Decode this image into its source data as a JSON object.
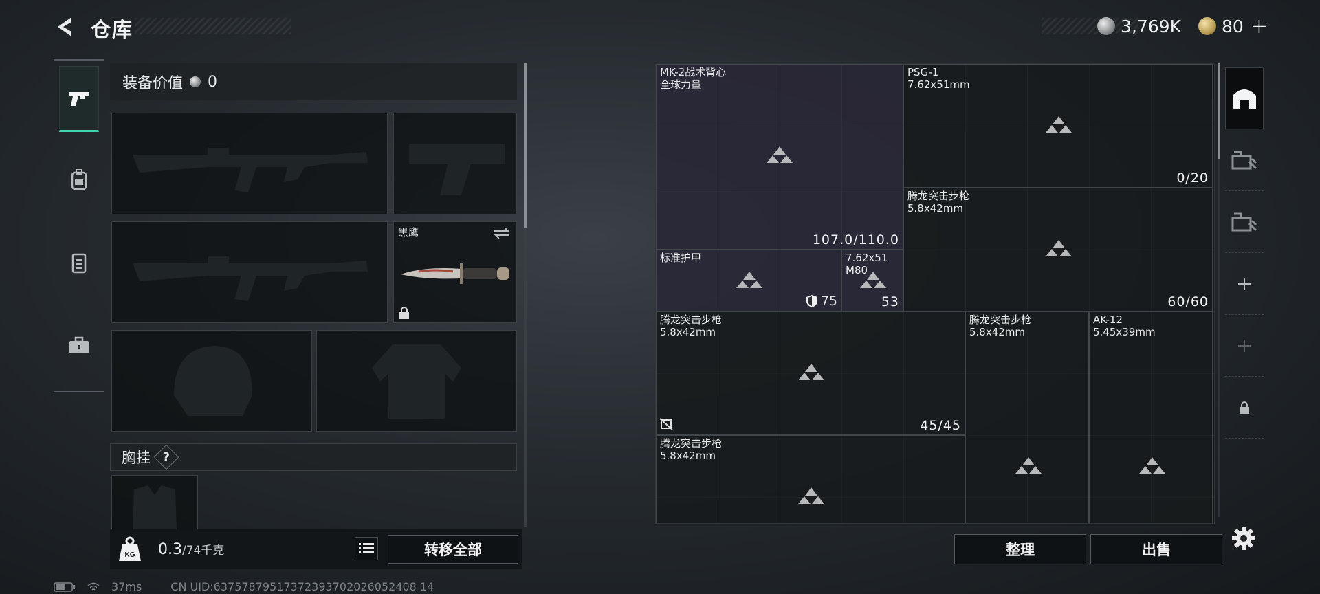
{
  "header": {
    "title": "仓库",
    "silver_amount": "3,769K",
    "gold_amount": "80",
    "gold_plus": "+"
  },
  "equipment": {
    "value_label": "装备价值",
    "value_amount": "0",
    "knife_name": "黑鹰",
    "chest_rig_label": "胸挂",
    "chest_rig_badge": "?"
  },
  "bottom": {
    "weight_current": "0.3",
    "weight_max": "/74千克",
    "transfer_all": "转移全部"
  },
  "status": {
    "ping": "37ms",
    "uid": "CN UID:63757879517372393702026052408 14"
  },
  "storage": {
    "items": [
      {
        "name": "MK-2战术背心\n全球力量",
        "count": "107.0/110.0"
      },
      {
        "name": "PSG-1\n7.62x51mm",
        "count": "0/20"
      },
      {
        "name": "腾龙突击步枪\n5.8x42mm",
        "count": "60/60"
      },
      {
        "name": "标准护甲",
        "count": "75"
      },
      {
        "name": "7.62x51\nM80",
        "count": "53"
      },
      {
        "name": "腾龙突击步枪\n5.8x42mm",
        "count": "45/45"
      },
      {
        "name": "腾龙突击步枪\n5.8x42mm",
        "count": ""
      },
      {
        "name": "AK-12\n5.45x39mm",
        "count": ""
      },
      {
        "name": "腾龙突击步枪\n5.8x42mm",
        "count": ""
      }
    ],
    "sort_label": "整理",
    "sell_label": "出售"
  },
  "colors": {
    "accent_tab": "#3fd7b0",
    "item_purple": "#3a344c"
  }
}
